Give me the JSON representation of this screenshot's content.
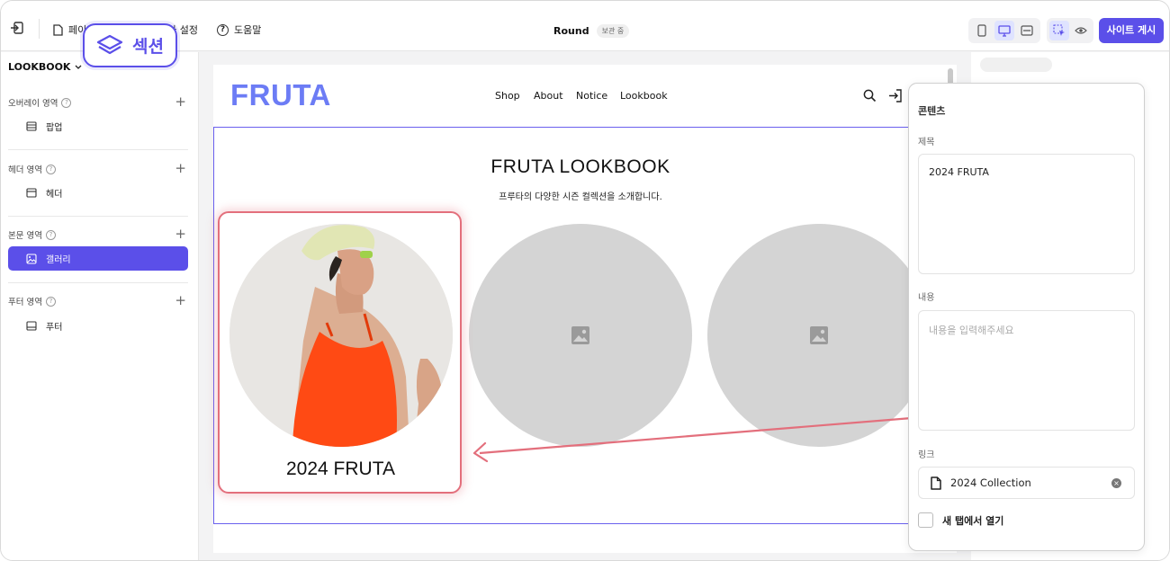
{
  "topbar": {
    "pages_label": "페이지",
    "theme_label": "테마 설정",
    "help_label": "도움말",
    "site_title": "Round",
    "save_status": "보관 중",
    "publish_label": "사이트 게시"
  },
  "callout": {
    "label": "섹션"
  },
  "sidebar": {
    "page_select": "LOOKBOOK",
    "groups": [
      {
        "title": "오버레이 영역",
        "item": "팝업"
      },
      {
        "title": "헤더 영역",
        "item": "헤더"
      },
      {
        "title": "본문 영역",
        "item": "갤러리"
      },
      {
        "title": "푸터 영역",
        "item": "푸터"
      }
    ]
  },
  "site": {
    "logo": "FRUTA",
    "nav": [
      "Shop",
      "About",
      "Notice",
      "Lookbook"
    ],
    "section_title": "FRUTA LOOKBOOK",
    "section_subtitle": "프루타의 다양한 시즌 컬렉션을 소개합니다.",
    "card_title": "2024 FRUTA"
  },
  "panel": {
    "heading": "콘텐츠",
    "title_label": "제목",
    "title_value": "2024 FRUTA",
    "content_label": "내용",
    "content_placeholder": "내용을 입력해주세요",
    "link_label": "링크",
    "link_value": "2024 Collection",
    "newtab_label": "새 탭에서 열기"
  },
  "colors": {
    "accent": "#5b4fe9",
    "logo": "#6c7cf5",
    "highlight": "#e36f7c",
    "swimsuit": "#ff4a14",
    "hat": "#dfe6b0"
  }
}
